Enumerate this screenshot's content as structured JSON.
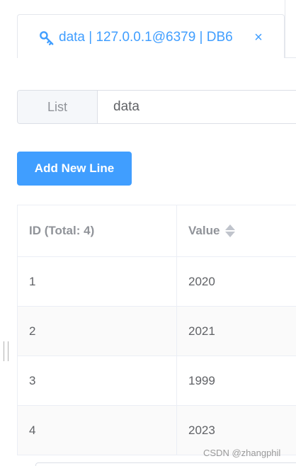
{
  "tab": {
    "title": "data | 127.0.0.1@6379 | DB6",
    "close_icon": "×",
    "icon": "key-icon",
    "accent_color": "#409eff"
  },
  "key_input": {
    "type_label": "List",
    "value": "data"
  },
  "toolbar": {
    "add_label": "Add New Line"
  },
  "table": {
    "columns": {
      "id": "ID (Total: 4)",
      "value": "Value"
    },
    "rows": [
      {
        "id": "1",
        "value": "2020"
      },
      {
        "id": "2",
        "value": "2021"
      },
      {
        "id": "3",
        "value": "1999"
      },
      {
        "id": "4",
        "value": "2023"
      }
    ]
  },
  "watermark": "CSDN @zhangphil"
}
